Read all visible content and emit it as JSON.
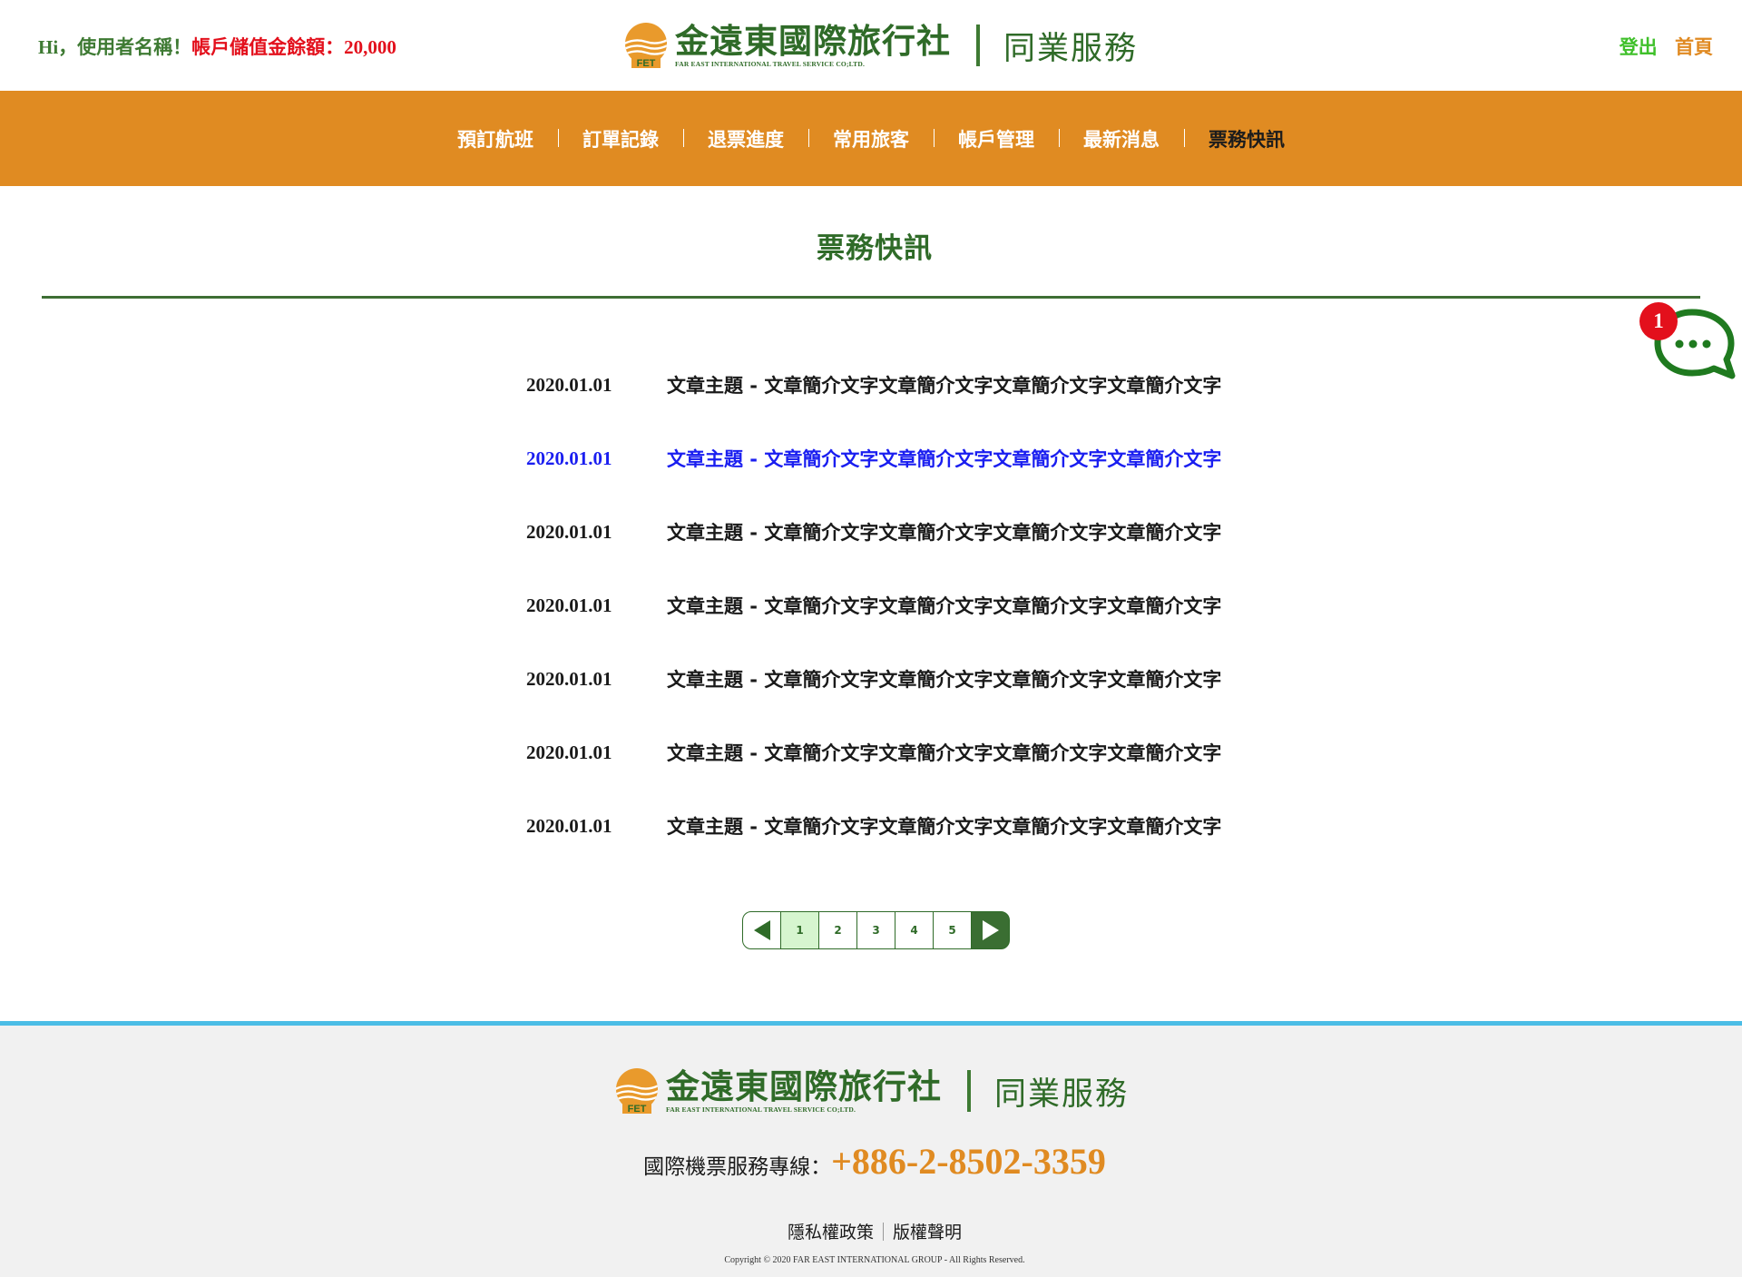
{
  "header": {
    "greeting": "Hi，使用者名稱！",
    "balance_label": "帳戶儲值金餘額：",
    "balance_value": "20,000",
    "logo_cn": "金遠東國際旅行社",
    "logo_en": "FAR EAST INTERNATIONAL TRAVEL SERVICE CO;LTD.",
    "logo_badge": "FET",
    "subtitle": "同業服務",
    "logout": "登出",
    "home": "首頁"
  },
  "nav": {
    "items": [
      "預訂航班",
      "訂單記錄",
      "退票進度",
      "常用旅客",
      "帳戶管理",
      "最新消息",
      "票務快訊"
    ],
    "active_index": 6
  },
  "main": {
    "title": "票務快訊",
    "articles": [
      {
        "date": "2020.01.01",
        "title": "文章主題 - 文章簡介文字文章簡介文字文章簡介文字文章簡介文字"
      },
      {
        "date": "2020.01.01",
        "title": "文章主題 - 文章簡介文字文章簡介文字文章簡介文字文章簡介文字"
      },
      {
        "date": "2020.01.01",
        "title": "文章主題 - 文章簡介文字文章簡介文字文章簡介文字文章簡介文字"
      },
      {
        "date": "2020.01.01",
        "title": "文章主題 - 文章簡介文字文章簡介文字文章簡介文字文章簡介文字"
      },
      {
        "date": "2020.01.01",
        "title": "文章主題 - 文章簡介文字文章簡介文字文章簡介文字文章簡介文字"
      },
      {
        "date": "2020.01.01",
        "title": "文章主題 - 文章簡介文字文章簡介文字文章簡介文字文章簡介文字"
      },
      {
        "date": "2020.01.01",
        "title": "文章主題 - 文章簡介文字文章簡介文字文章簡介文字文章簡介文字"
      }
    ],
    "hovered_article_index": 1
  },
  "pagination": {
    "pages": [
      "1",
      "2",
      "3",
      "4",
      "5"
    ],
    "current": "1",
    "prev_icon": "triangle-left-icon",
    "next_icon": "triangle-right-icon"
  },
  "chat_widget": {
    "icon": "chat-bubble-icon",
    "badge_count": "1"
  },
  "footer": {
    "phone_label": "國際機票服務專線：",
    "phone_number": "+886-2-8502-3359",
    "privacy": "隱私權政策",
    "copyright_notice": "版權聲明",
    "copyright": "Copyright © 2020 FAR EAST INTERNATIONAL GROUP - All Rights Reserved."
  },
  "colors": {
    "brand_green": "#2f6b28",
    "brand_orange": "#e08b22",
    "alert_red": "#e3101c",
    "link_blue": "#1a1ef0",
    "footer_accent": "#4bbde6"
  }
}
